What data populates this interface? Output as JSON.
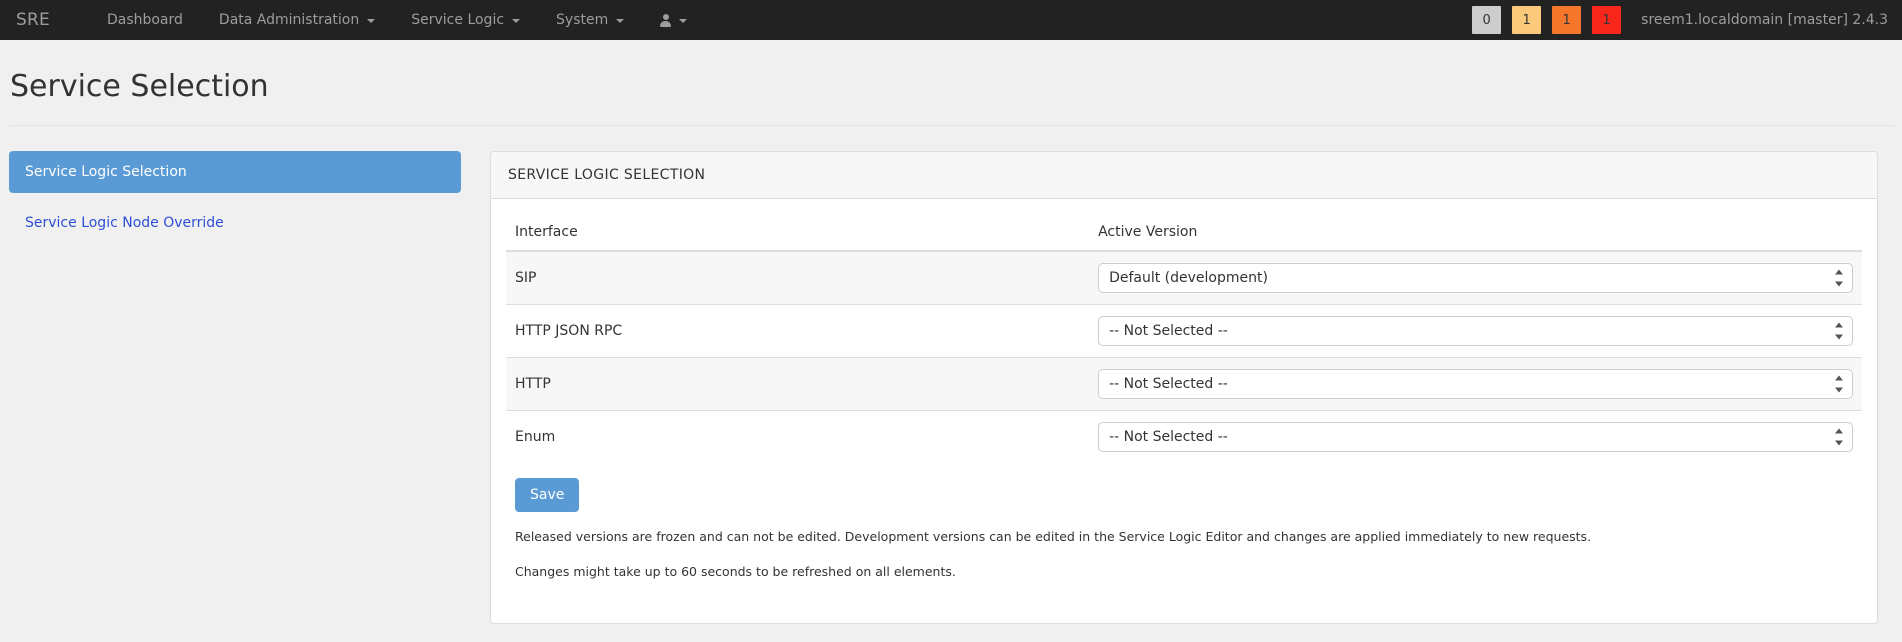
{
  "navbar": {
    "brand": "SRE",
    "links": [
      {
        "label": "Dashboard",
        "has_caret": false,
        "name": "nav-dashboard"
      },
      {
        "label": "Data Administration",
        "has_caret": true,
        "name": "nav-data-administration"
      },
      {
        "label": "Service Logic",
        "has_caret": true,
        "name": "nav-service-logic"
      },
      {
        "label": "System",
        "has_caret": true,
        "name": "nav-system"
      }
    ],
    "user_menu": {
      "icon": "user-icon",
      "has_caret": true
    },
    "badges": [
      {
        "value": "0",
        "color": "#cccccc"
      },
      {
        "value": "1",
        "color": "#fac979"
      },
      {
        "value": "1",
        "color": "#f4762a"
      },
      {
        "value": "1",
        "color": "#f7281b"
      }
    ],
    "host": "sreem1.localdomain [master] 2.4.3"
  },
  "page": {
    "title": "Service Selection"
  },
  "sidebar": {
    "items": [
      {
        "label": "Service Logic Selection",
        "active": true
      },
      {
        "label": "Service Logic Node Override",
        "active": false
      }
    ]
  },
  "panel": {
    "heading": "SERVICE LOGIC SELECTION",
    "table": {
      "headers": [
        "Interface",
        "Active Version"
      ],
      "rows": [
        {
          "interface": "SIP",
          "selected": "Default (development)",
          "options": [
            "-- Not Selected --",
            "Default (development)"
          ]
        },
        {
          "interface": "HTTP JSON RPC",
          "selected": "-- Not Selected --",
          "options": [
            "-- Not Selected --",
            "Default (development)"
          ]
        },
        {
          "interface": "HTTP",
          "selected": "-- Not Selected --",
          "options": [
            "-- Not Selected --",
            "Default (development)"
          ]
        },
        {
          "interface": "Enum",
          "selected": "-- Not Selected --",
          "options": [
            "-- Not Selected --",
            "Default (development)"
          ]
        }
      ]
    },
    "save_label": "Save",
    "note_1": "Released versions are frozen and can not be edited. Development versions can be edited in the Service Logic Editor and changes are applied immediately to new requests.",
    "note_2": "Changes might take up to 60 seconds to be refreshed on all elements."
  },
  "colors": {
    "navbar_bg": "#222222",
    "accent_blue": "#5b9bd5",
    "link_blue": "#2f4fd8",
    "page_bg": "#f0f0f0"
  }
}
